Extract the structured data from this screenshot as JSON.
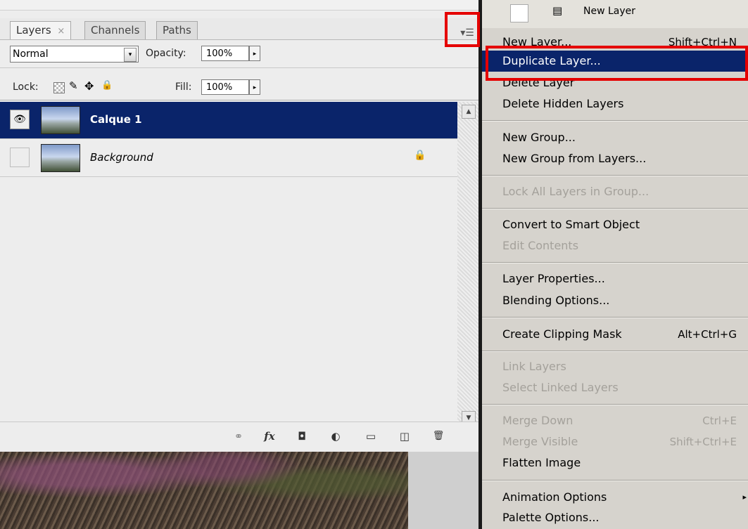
{
  "panel": {
    "tabs": [
      {
        "label": "Layers",
        "close": "×",
        "active": true
      },
      {
        "label": "Channels",
        "active": false
      },
      {
        "label": "Paths",
        "active": false
      }
    ],
    "menu_button": "▾☰",
    "blend_mode": "Normal",
    "opacity_label": "Opacity:",
    "opacity_value": "100%",
    "lock_label": "Lock:",
    "fill_label": "Fill:",
    "fill_value": "100%",
    "arrow": "▸",
    "dropdown_arrow": "▾",
    "layers": [
      {
        "name": "Calque 1",
        "selected": true,
        "visible": true
      },
      {
        "name": "Background",
        "selected": false,
        "visible": false,
        "locked": true
      }
    ],
    "eye_glyph": "👁",
    "lock_glyph": "🔒",
    "toolbar": {
      "link": "⚭",
      "fx": "fx",
      "mask": "◘",
      "adjust": "◐",
      "group": "▭",
      "new": "◫",
      "trash": "🗑"
    }
  },
  "menu": {
    "topbar_label": "New Layer",
    "items": [
      {
        "label": "New Layer...",
        "shortcut": "Shift+Ctrl+N"
      },
      {
        "label": "Duplicate Layer...",
        "highlighted": true
      },
      {
        "label": "Delete Layer"
      },
      {
        "label": "Delete Hidden Layers"
      },
      {
        "label": "New Group..."
      },
      {
        "label": "New Group from Layers..."
      },
      {
        "label": "Lock All Layers in Group...",
        "disabled": true
      },
      {
        "label": "Convert to Smart Object"
      },
      {
        "label": "Edit Contents",
        "disabled": true
      },
      {
        "label": "Layer Properties..."
      },
      {
        "label": "Blending Options..."
      },
      {
        "label": "Create Clipping Mask",
        "shortcut": "Alt+Ctrl+G"
      },
      {
        "label": "Link Layers",
        "disabled": true
      },
      {
        "label": "Select Linked Layers",
        "disabled": true
      },
      {
        "label": "Merge Down",
        "shortcut": "Ctrl+E",
        "disabled": true
      },
      {
        "label": "Merge Visible",
        "shortcut": "Shift+Ctrl+E",
        "disabled": true
      },
      {
        "label": "Flatten Image"
      },
      {
        "label": "Animation Options",
        "submenu": "▸"
      },
      {
        "label": "Palette Options..."
      }
    ]
  }
}
